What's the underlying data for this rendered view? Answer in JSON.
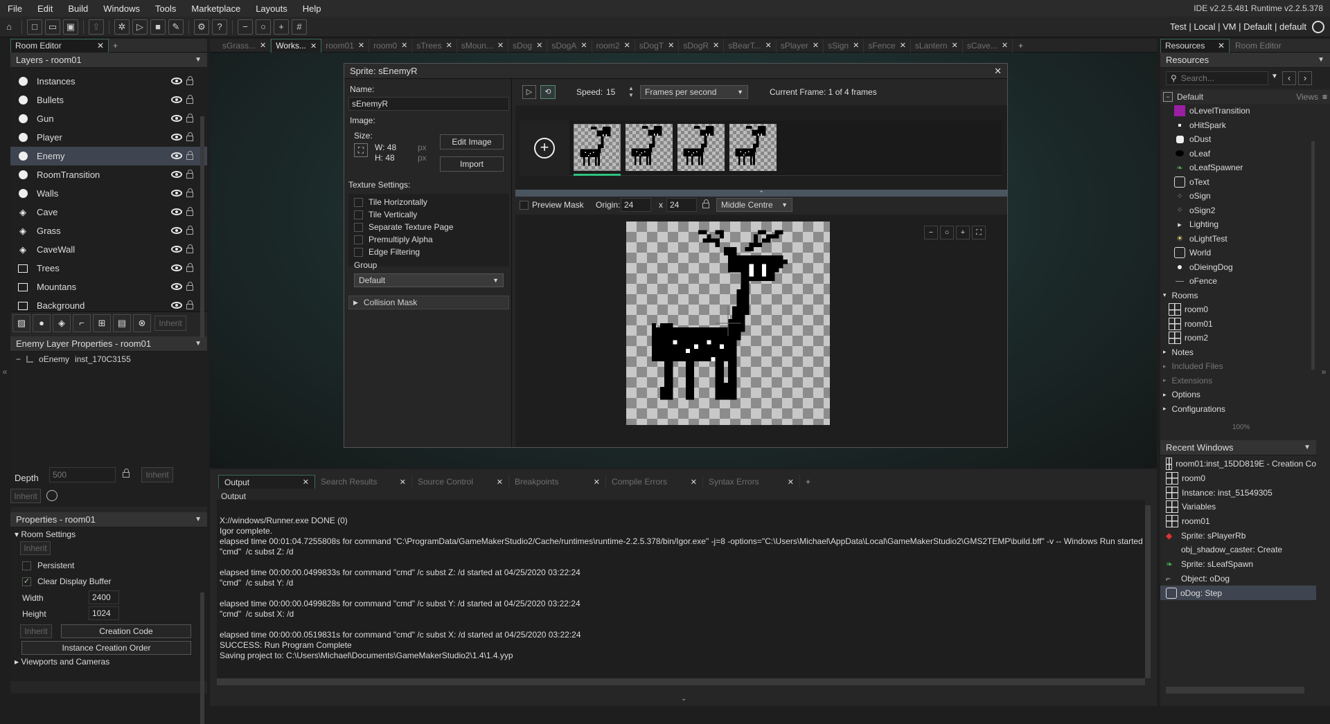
{
  "menu": [
    "File",
    "Edit",
    "Build",
    "Windows",
    "Tools",
    "Marketplace",
    "Layouts",
    "Help"
  ],
  "version": "IDE v2.2.5.481  Runtime v2.2.5.378",
  "target": "Test | Local | VM | Default | default",
  "left": {
    "tab": "Room Editor",
    "layers_title": "Layers - room01",
    "layers": [
      {
        "name": "Instances",
        "icon": "instance"
      },
      {
        "name": "Bullets",
        "icon": "instance"
      },
      {
        "name": "Gun",
        "icon": "instance"
      },
      {
        "name": "Player",
        "icon": "instance"
      },
      {
        "name": "Enemy",
        "icon": "instance",
        "selected": true
      },
      {
        "name": "RoomTransition",
        "icon": "instance"
      },
      {
        "name": "Walls",
        "icon": "instance"
      },
      {
        "name": "Cave",
        "icon": "tile"
      },
      {
        "name": "Grass",
        "icon": "tile"
      },
      {
        "name": "CaveWall",
        "icon": "tile"
      },
      {
        "name": "Trees",
        "icon": "background"
      },
      {
        "name": "Mountans",
        "icon": "background"
      },
      {
        "name": "Background",
        "icon": "background"
      }
    ],
    "inherit_label": "Inherit",
    "layer_props_title": "Enemy Layer Properties - room01",
    "instance_object": "oEnemy",
    "instance_id": "inst_170C3155",
    "depth_label": "Depth",
    "depth_value": "500",
    "props_title": "Properties - room01",
    "room_settings": "Room Settings",
    "persistent": "Persistent",
    "clear_display": "Clear Display Buffer",
    "width_label": "Width",
    "width_value": "2400",
    "height_label": "Height",
    "height_value": "1024",
    "creation_code": "Creation Code",
    "instance_creation_order": "Instance Creation Order",
    "viewports": "Viewports and Cameras"
  },
  "doc_tabs": [
    "sGrass...",
    "Works...",
    "room01",
    "room0",
    "sTrees",
    "sMoun...",
    "sDog",
    "sDogA",
    "room2",
    "sDogT",
    "sDogR",
    "sBearT...",
    "sPlayer",
    "sSign",
    "sFence",
    "sLantern",
    "sCave..."
  ],
  "active_doc_tab": 1,
  "sprite": {
    "title": "Sprite: sEnemyR",
    "name_label": "Name:",
    "name_value": "sEnemyR",
    "image_label": "Image:",
    "size_label": "Size:",
    "w_label": "W: 48",
    "h_label": "H: 48",
    "px": "px",
    "edit_image": "Edit Image",
    "import": "Import",
    "texture_label": "Texture Settings:",
    "texture_options": [
      "Tile Horizontally",
      "Tile Vertically",
      "Separate Texture Page",
      "Premultiply Alpha",
      "Edge Filtering"
    ],
    "group_label": "Group",
    "group_value": "Default",
    "collision_mask": "Collision Mask",
    "speed_label": "Speed:",
    "speed_value": "15",
    "speed_unit": "Frames per second",
    "current_frame": "Current Frame: 1 of 4 frames",
    "preview_mask": "Preview Mask",
    "origin_label": "Origin:",
    "origin_x": "24",
    "origin_sep": "x",
    "origin_y": "24",
    "origin_preset": "Middle Centre",
    "frame_count": 4
  },
  "bottom": {
    "tabs": [
      "Output",
      "Search Results",
      "Source Control",
      "Breakpoints",
      "Compile Errors",
      "Syntax Errors"
    ],
    "output_header": "Output",
    "lines": [
      "",
      "X://windows/Runner.exe DONE (0)",
      "Igor complete.",
      "elapsed time 00:01:04.7255808s for command \"C:\\ProgramData/GameMakerStudio2/Cache/runtimes\\runtime-2.2.5.378/bin/Igor.exe\" -j=8 -options=\"C:\\Users\\Michael\\AppData\\Local\\GameMakerStudio2\\GMS2TEMP\\build.bff\" -v -- Windows Run started at 04",
      "\"cmd\"  /c subst Z: /d",
      "",
      "elapsed time 00:00:00.0499833s for command \"cmd\" /c subst Z: /d started at 04/25/2020 03:22:24",
      "\"cmd\"  /c subst Y: /d",
      "",
      "elapsed time 00:00:00.0499828s for command \"cmd\" /c subst Y: /d started at 04/25/2020 03:22:24",
      "\"cmd\"  /c subst X: /d",
      "",
      "elapsed time 00:00:00.0519831s for command \"cmd\" /c subst X: /d started at 04/25/2020 03:22:24",
      "SUCCESS: Run Program Complete",
      "Saving project to: C:\\Users\\Michael\\Documents\\GameMakerStudio2\\1.4\\1.4.yyp"
    ]
  },
  "right": {
    "tabs": [
      "Resources",
      "Room Editor"
    ],
    "resources_title": "Resources",
    "search_placeholder": "Search...",
    "group": "Default",
    "views": "Views",
    "items": [
      {
        "name": "oLevelTransition",
        "icon": "purple"
      },
      {
        "name": "oHitSpark",
        "icon": "small"
      },
      {
        "name": "oDust",
        "icon": "white"
      },
      {
        "name": "oLeaf",
        "icon": "black"
      },
      {
        "name": "oLeafSpawner",
        "icon": "leaf"
      },
      {
        "name": "oText",
        "icon": "square"
      },
      {
        "name": "oSign",
        "icon": "dots"
      },
      {
        "name": "oSign2",
        "icon": "dots"
      },
      {
        "name": "Lighting",
        "icon": "folder"
      },
      {
        "name": "oLightTest",
        "icon": "bulb"
      },
      {
        "name": "World",
        "icon": "square"
      },
      {
        "name": "oDieingDog",
        "icon": "dot"
      },
      {
        "name": "oFence",
        "icon": "line"
      }
    ],
    "rooms_label": "Rooms",
    "rooms": [
      "room0",
      "room01",
      "room2"
    ],
    "folders": [
      "Notes",
      "Included Files",
      "Extensions",
      "Options",
      "Configurations"
    ],
    "zoom": "100%",
    "recent_title": "Recent Windows",
    "recent": [
      "room01:inst_15DD819E - Creation Co",
      "room0",
      "Instance: inst_51549305",
      "Variables",
      "room01",
      "Sprite: sPlayerRb",
      "obj_shadow_caster: Create",
      "Sprite: sLeafSpawn",
      "Object: oDog",
      "oDog: Step"
    ]
  }
}
